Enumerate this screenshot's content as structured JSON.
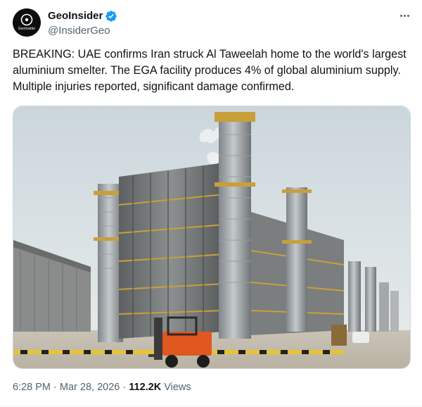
{
  "account": {
    "display_name": "GeoInsider",
    "handle": "@InsiderGeo",
    "avatar_text": "GeoInsider",
    "verified": true,
    "brand_color": "#1d9bf0"
  },
  "tweet": {
    "text": "BREAKING: UAE confirms Iran struck Al Taweelah home to the world's largest aluminium smelter. The EGA facility produces 4% of global aluminium supply. Multiple injuries reported, significant damage confirmed.",
    "time": "6:28 PM",
    "separator": "·",
    "date": "Mar 28, 2026",
    "views_count": "112.2K",
    "views_label": "Views"
  },
  "media": {
    "icon": "industrial-plant-photo"
  },
  "icons": {
    "more": "more-horizontal-icon",
    "verified": "verified-badge-icon"
  }
}
